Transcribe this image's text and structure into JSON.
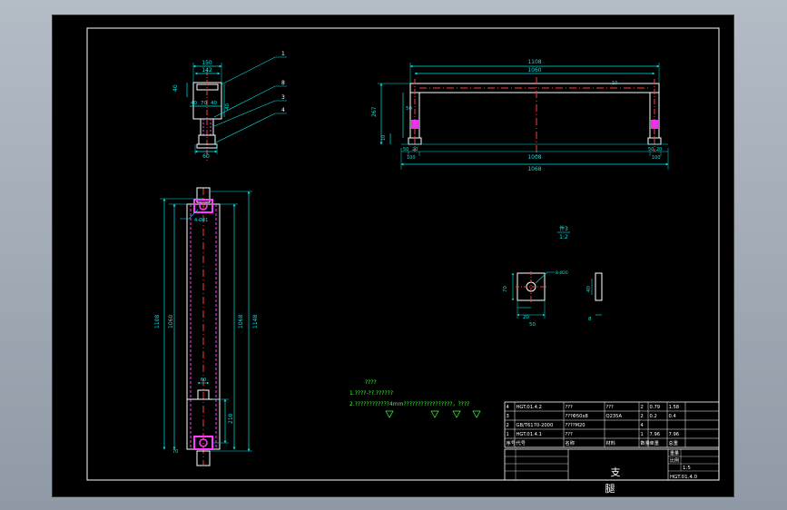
{
  "callouts": [
    "1",
    "8",
    "3",
    "4"
  ],
  "dims": {
    "side_top_outer": "150",
    "side_top_inner": "142",
    "side_left": "40",
    "side_mid_a": "40",
    "side_mid_b": "70",
    "side_mid_c": "40",
    "side_right": "40",
    "side_bottom": "60",
    "front_top_outer": "1108",
    "front_top_inner": "1060",
    "front_right_small": "10",
    "front_height": "267",
    "front_inner_left": "50",
    "front_small_left": "10",
    "front_bot_a": "50",
    "front_bot_b": "20",
    "front_bot_c": "100",
    "front_bot_mid": "1008",
    "front_bot_right_a": "50",
    "front_bot_right_b": "20",
    "front_bot_right_c": "100",
    "front_bottom_total": "1068",
    "plan_left_outer": "1108",
    "plan_left_inner": "1060",
    "plan_right_inner": "1068",
    "plan_right_outer": "1148",
    "plan_hole": "4-Ø41",
    "plan_slot": "60",
    "plan_bottom_gap": "210",
    "plan_bottom_small": "70"
  },
  "detail": {
    "label_top": "件3",
    "label_scale": "1:2",
    "hole": "8-Ø20",
    "width_70": "70",
    "bottom_20": "20",
    "bottom_50": "50",
    "side_40": "40",
    "side_8": "8"
  },
  "notes": {
    "title": "????",
    "line1": "1.????-??.??????",
    "line2": "2.????????????4mm?????????????????，????"
  },
  "parts_table": [
    [
      "4",
      "HGT.01.4.2",
      "???",
      "???",
      "2",
      "0.79",
      "1.58"
    ],
    [
      "3",
      "",
      "???Φ50x8",
      "Q235A",
      "2",
      "0.2",
      "0.4"
    ],
    [
      "2",
      "GB/T6170-2000",
      "????M20",
      "",
      "4",
      "",
      ""
    ],
    [
      "1",
      "HGT.01.4.1",
      "???",
      "",
      "1",
      "7.96",
      "7.96"
    ]
  ],
  "table_header": [
    "序号",
    "代号",
    "名称",
    "材料",
    "数量",
    "单重",
    "总重"
  ],
  "title_block": {
    "name1": "支",
    "name2": "腿",
    "scale": "1:5",
    "drawing_no": "HGT.01.4.0",
    "small1": "重量",
    "small2": "比例"
  },
  "colors": {
    "outline": "#ffffff",
    "dimension": "#00e5e5",
    "centerline": "#ff3b3b",
    "hidden": "#ff3bff",
    "note": "#39ff39"
  }
}
